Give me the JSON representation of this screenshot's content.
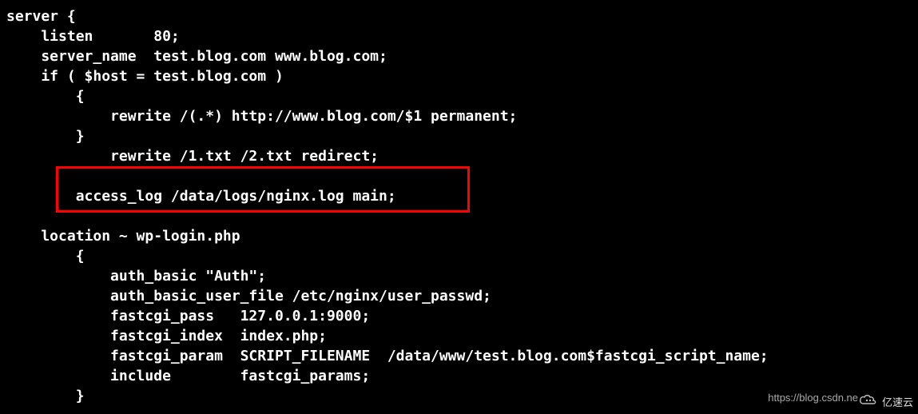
{
  "code": {
    "l1": "server {",
    "l2": "    listen       80;",
    "l3": "    server_name  test.blog.com www.blog.com;",
    "l4": "    if ( $host = test.blog.com )",
    "l5": "        {",
    "l6": "            rewrite /(.*) http://www.blog.com/$1 permanent;",
    "l7": "        }",
    "l8": "            rewrite /1.txt /2.txt redirect;",
    "l9": "",
    "l10": "        access_log /data/logs/nginx.log main;",
    "l11": "",
    "l12": "    location ~ wp-login.php",
    "l13": "        {",
    "l14": "            auth_basic \"Auth\";",
    "l15": "            auth_basic_user_file /etc/nginx/user_passwd;",
    "l16": "            fastcgi_pass   127.0.0.1:9000;",
    "l17": "            fastcgi_index  index.php;",
    "l18": "            fastcgi_param  SCRIPT_FILENAME  /data/www/test.blog.com$fastcgi_script_name;",
    "l19": "            include        fastcgi_params;",
    "l20": "        }"
  },
  "watermark": {
    "url": "https://blog.csdn.ne",
    "brand": "亿速云"
  }
}
